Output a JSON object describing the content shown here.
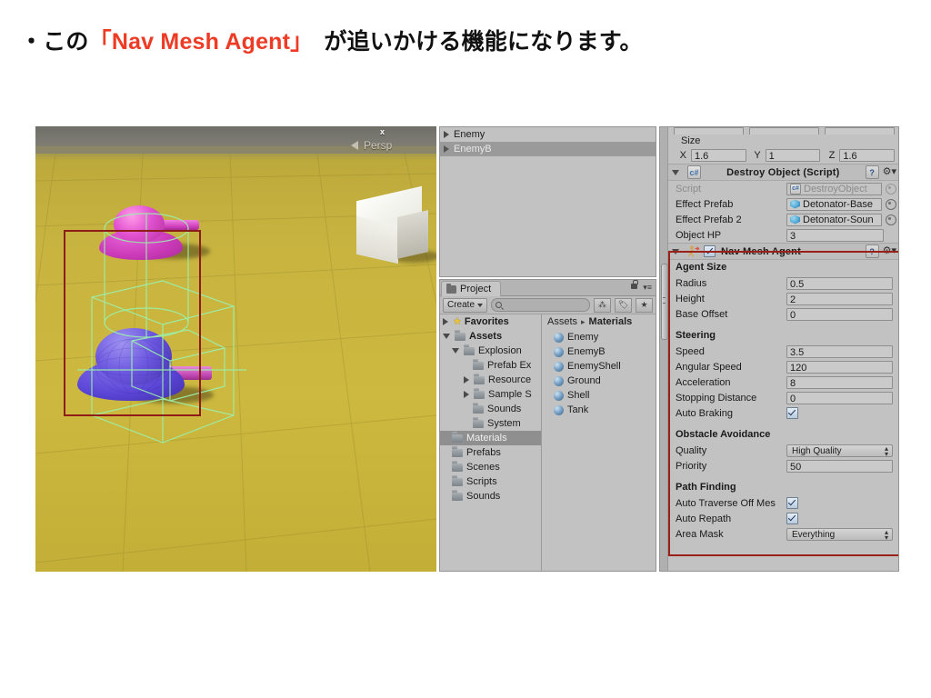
{
  "slide": {
    "bullet": "・",
    "text_before": "この",
    "quote_open": "「",
    "accent_text": "Nav Mesh Agent",
    "quote_close": "」",
    "text_after": "が追いかける機能になります。",
    "accent_color": "#ee3b25"
  },
  "scene_view": {
    "gizmo_axis_label": "x",
    "projection_label": "Persp",
    "ground_color": "#c7b33f",
    "selection_outline_color": "#8d1d16",
    "navmesh_wire_color": "#9bf0ab",
    "objects": [
      {
        "name": "enemy-tank-magenta",
        "color": "#cc3ab9"
      },
      {
        "name": "enemy-tank-blue",
        "color": "#5a45d6"
      },
      {
        "name": "white-cube",
        "color": "#f2f2ec"
      }
    ]
  },
  "hierarchy": {
    "items": [
      {
        "label": "Enemy",
        "selected": false
      },
      {
        "label": "EnemyB",
        "selected": true
      }
    ]
  },
  "project": {
    "tab_label": "Project",
    "create_label": "Create",
    "search_value": "",
    "breadcrumb": {
      "root": "Assets",
      "sep": "▸",
      "current": "Materials"
    },
    "favorites_label": "Favorites",
    "tree": [
      {
        "label": "Assets",
        "indent": 0,
        "arrow": "down",
        "selected": false
      },
      {
        "label": "Explosion",
        "indent": 1,
        "arrow": "down",
        "selected": false
      },
      {
        "label": "Prefab Ex",
        "indent": 2,
        "arrow": "none",
        "selected": false
      },
      {
        "label": "Resource",
        "indent": 2,
        "arrow": "right",
        "selected": false
      },
      {
        "label": "Sample S",
        "indent": 2,
        "arrow": "right",
        "selected": false
      },
      {
        "label": "Sounds",
        "indent": 2,
        "arrow": "none",
        "selected": false
      },
      {
        "label": "System",
        "indent": 2,
        "arrow": "none",
        "selected": false
      },
      {
        "label": "Materials",
        "indent": 1,
        "arrow": "none",
        "selected": true
      },
      {
        "label": "Prefabs",
        "indent": 1,
        "arrow": "none",
        "selected": false
      },
      {
        "label": "Scenes",
        "indent": 1,
        "arrow": "none",
        "selected": false
      },
      {
        "label": "Scripts",
        "indent": 1,
        "arrow": "none",
        "selected": false
      },
      {
        "label": "Sounds",
        "indent": 1,
        "arrow": "none",
        "selected": false
      }
    ],
    "assets": [
      {
        "label": "Enemy"
      },
      {
        "label": "EnemyB"
      },
      {
        "label": "EnemyShell"
      },
      {
        "label": "Ground"
      },
      {
        "label": "Shell"
      },
      {
        "label": "Tank"
      }
    ]
  },
  "inspector": {
    "size": {
      "label": "Size",
      "axes": [
        {
          "axis": "X",
          "value": "1.6"
        },
        {
          "axis": "Y",
          "value": "1"
        },
        {
          "axis": "Z",
          "value": "1.6"
        }
      ]
    },
    "destroy_object": {
      "title": "Destroy Object (Script)",
      "rows": [
        {
          "label": "Script",
          "value": "DestroyObject",
          "kind": "object-ref-disabled"
        },
        {
          "label": "Effect Prefab",
          "value": "Detonator-Base",
          "kind": "object-ref"
        },
        {
          "label": "Effect Prefab 2",
          "value": "Detonator-Soun",
          "kind": "object-ref"
        },
        {
          "label": "Object HP",
          "value": "3",
          "kind": "number"
        }
      ]
    },
    "nav_mesh_agent": {
      "title": "Nav Mesh Agent",
      "enabled": true,
      "highlight_color": "#9a2018",
      "groups": [
        {
          "heading": "Agent Size",
          "rows": [
            {
              "label": "Radius",
              "value": "0.5",
              "kind": "number"
            },
            {
              "label": "Height",
              "value": "2",
              "kind": "number"
            },
            {
              "label": "Base Offset",
              "value": "0",
              "kind": "number"
            }
          ]
        },
        {
          "heading": "Steering",
          "rows": [
            {
              "label": "Speed",
              "value": "3.5",
              "kind": "number"
            },
            {
              "label": "Angular Speed",
              "value": "120",
              "kind": "number"
            },
            {
              "label": "Acceleration",
              "value": "8",
              "kind": "number"
            },
            {
              "label": "Stopping Distance",
              "value": "0",
              "kind": "number"
            },
            {
              "label": "Auto Braking",
              "value": true,
              "kind": "checkbox"
            }
          ]
        },
        {
          "heading": "Obstacle Avoidance",
          "rows": [
            {
              "label": "Quality",
              "value": "High Quality",
              "kind": "popup"
            },
            {
              "label": "Priority",
              "value": "50",
              "kind": "number"
            }
          ]
        },
        {
          "heading": "Path Finding",
          "rows": [
            {
              "label": "Auto Traverse Off Mes",
              "value": true,
              "kind": "checkbox"
            },
            {
              "label": "Auto Repath",
              "value": true,
              "kind": "checkbox"
            },
            {
              "label": "Area Mask",
              "value": "Everything",
              "kind": "popup"
            }
          ]
        }
      ]
    }
  }
}
